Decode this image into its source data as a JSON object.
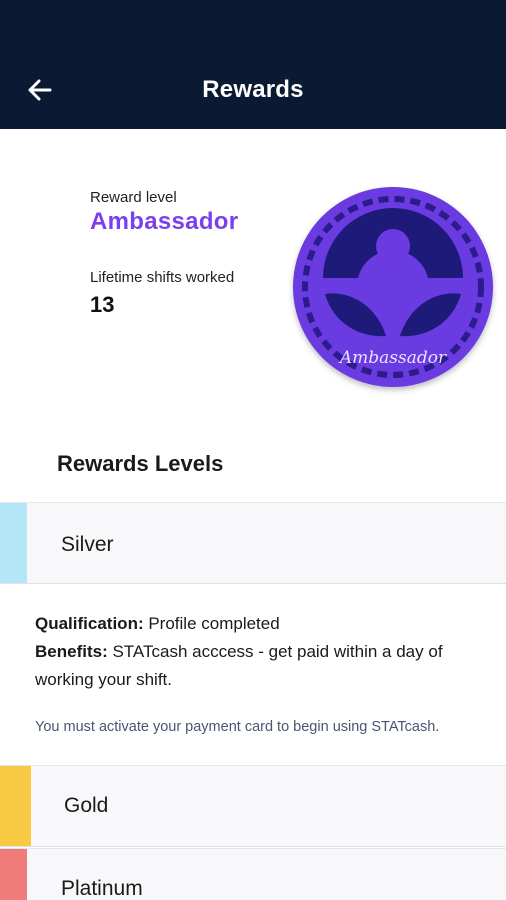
{
  "header": {
    "title": "Rewards",
    "back_icon": "arrow-left-icon",
    "background": "#0b1a33"
  },
  "summary": {
    "reward_level_label": "Reward level",
    "reward_level": "Ambassador",
    "lifetime_shifts_label": "Lifetime shifts worked",
    "lifetime_shifts": "13",
    "badge": {
      "icon": "ambassador-badge-icon",
      "text": "Ambassador",
      "color": "#7b3ff2"
    }
  },
  "levels_section": {
    "title": "Rewards Levels",
    "levels": [
      {
        "name": "Silver",
        "color": "#b5e6f7",
        "qualification_label": "Qualification:",
        "qualification": " Profile completed",
        "benefits_label": "Benefits:",
        "benefits": " STATcash acccess - get paid within a day of working your shift.",
        "note": "You must activate your payment card to begin using STATcash."
      },
      {
        "name": "Gold",
        "color": "#f8c943"
      },
      {
        "name": "Platinum",
        "color": "#f07b7b"
      }
    ]
  }
}
